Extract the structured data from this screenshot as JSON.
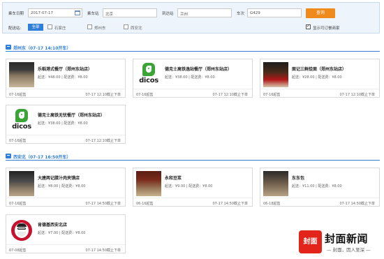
{
  "search": {
    "date_label": "乘车日期",
    "date_value": "2017-07-17",
    "from_label": "乘车站",
    "from_value": "北京",
    "to_label": "到达站",
    "to_value": "兰州",
    "train_label": "车次",
    "train_value": "G429",
    "query_label": "查询",
    "filter_label": "配送站:",
    "filter_all": "全部",
    "filter_options": [
      "石家庄",
      "郑州东",
      "西安北"
    ],
    "bookable_label": "显示可订餐商家"
  },
  "sections": [
    {
      "title": "郑州东（07-17 14:10开车）",
      "cards": [
        {
          "name": "乐稻港式餐厅（郑州东站店）",
          "price": "起送：¥48.00 | 配送费：¥8.00",
          "start": "07-16起售",
          "end": "07-17 12:10截止下单",
          "thumb": "photo"
        },
        {
          "name": "德克士高铁逸站餐厅（郑州东站店）",
          "price": "起送：¥38.00 | 配送费：¥8.00",
          "start": "07-16起售",
          "end": "07-17 12:10截止下单",
          "thumb": "dicos"
        },
        {
          "name": "面记三鲜烩面（郑州东站店）",
          "price": "起送：¥28.00 | 配送费：¥8.00",
          "start": "07-16起售",
          "end": "07-17 12:10截止下单",
          "thumb": "photo"
        },
        {
          "name": "德克士高铁无忧餐厅（郑州东站店）",
          "price": "起送：¥38.00 | 配送费：¥8.00",
          "start": "07-16起售",
          "end": "07-17 12:10截止下单",
          "thumb": "dicos"
        }
      ]
    },
    {
      "title": "西安北（07-17 16:50开车）",
      "cards": [
        {
          "name": "大唐两记腊汁肉夹馍店",
          "price": "起送：¥8.00 | 配送费：¥8.00",
          "start": "07-16起售",
          "end": "07-17 14:50截止下单",
          "thumb": "photo"
        },
        {
          "name": "永和豆浆",
          "price": "起送：¥9.00 | 配送费：¥8.00",
          "start": "06-16起售",
          "end": "07-17 14:50截止下单",
          "thumb": "photo"
        },
        {
          "name": "东东包",
          "price": "起送：¥11.00 | 配送费：¥8.00",
          "start": "06-18起售",
          "end": "07-17 14:50截止下单",
          "thumb": "photo"
        },
        {
          "name": "肯德基西安北店",
          "price": "起送：¥7.00 | 配送费：¥8.00",
          "start": "07-08起售",
          "end": "07-17 14:50截止下单",
          "thumb": "kfc"
        }
      ]
    }
  ],
  "watermark": {
    "logo_text": "封面",
    "title": "封面新闻",
    "slogan": "— 封面，因人至深 —"
  },
  "colors": {
    "accent": "#2f7fd8",
    "query_button": "#f18a1c",
    "dicos_green": "#3aa536",
    "kfc_red": "#c8102e",
    "watermark_red": "#e2241b"
  }
}
